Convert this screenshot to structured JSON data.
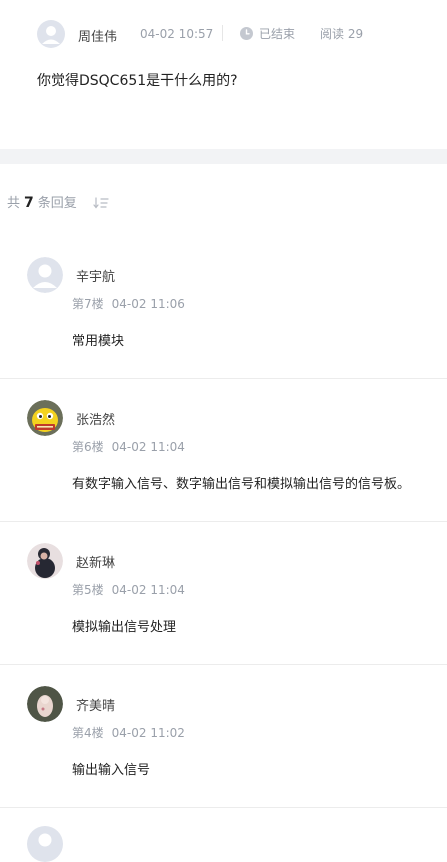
{
  "post": {
    "author": "周佳伟",
    "time": "04-02 10:57",
    "status": "已结束",
    "reads": "阅读 29",
    "question": "你觉得DSQC651是干什么用的?"
  },
  "replies_header": {
    "prefix": "共",
    "count": "7",
    "suffix": "条回复",
    "sort_icon": "sort-icon"
  },
  "replies": [
    {
      "name": "辛宇航",
      "floor": "第7楼",
      "time": "04-02 11:06",
      "content": "常用模块",
      "avatar": "default-avatar"
    },
    {
      "name": "张浩然",
      "floor": "第6楼",
      "time": "04-02 11:04",
      "content": "有数字输入信号、数字输出信号和模拟输出信号的信号板。",
      "avatar": "cartoon-avatar"
    },
    {
      "name": "赵新琳",
      "floor": "第5楼",
      "time": "04-02 11:04",
      "content": "模拟输出信号处理",
      "avatar": "photo-avatar"
    },
    {
      "name": "齐美晴",
      "floor": "第4楼",
      "time": "04-02 11:02",
      "content": "输出输入信号",
      "avatar": "photo-avatar"
    }
  ],
  "colors": {
    "muted": "#9aa0aa",
    "divider": "#ececec",
    "section_gap": "#f2f3f5",
    "avatar_default": "#dfe3ec"
  }
}
